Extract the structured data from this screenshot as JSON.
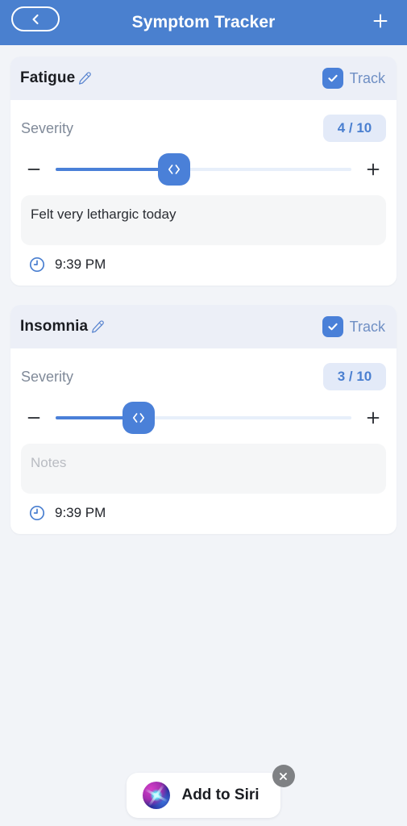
{
  "header": {
    "title": "Symptom Tracker",
    "back_icon": "chevron-left-icon",
    "add_icon": "plus-icon"
  },
  "labels": {
    "severity": "Severity",
    "track": "Track",
    "notes_placeholder": "Notes",
    "edit_icon": "pencil-icon",
    "clock_icon": "clock-icon",
    "minus_icon": "minus-icon",
    "plus_icon": "plus-icon",
    "thumb_icon": "left-right-chevrons-icon"
  },
  "colors": {
    "accent": "#4a80d8",
    "header_bg": "#4a80cf",
    "page_bg": "#f2f4f8",
    "card_header_bg": "#eceff7",
    "badge_bg": "#e3eaf8",
    "badge_text": "#4a7fd0"
  },
  "symptoms": [
    {
      "name": "Fatigue",
      "tracked": true,
      "track_label": "Track",
      "severity_label": "Severity",
      "severity_value": 4,
      "severity_max": 10,
      "severity_display": "4 / 10",
      "slider_percent": 40,
      "notes": "Felt very lethargic today",
      "notes_is_placeholder": false,
      "time": "9:39 PM"
    },
    {
      "name": "Insomnia",
      "tracked": true,
      "track_label": "Track",
      "severity_label": "Severity",
      "severity_value": 3,
      "severity_max": 10,
      "severity_display": "3 / 10",
      "slider_percent": 28,
      "notes": "Notes",
      "notes_is_placeholder": true,
      "time": "9:39 PM"
    }
  ],
  "siri": {
    "label": "Add to Siri",
    "orb_icon": "siri-orb-icon",
    "close_icon": "close-icon"
  }
}
